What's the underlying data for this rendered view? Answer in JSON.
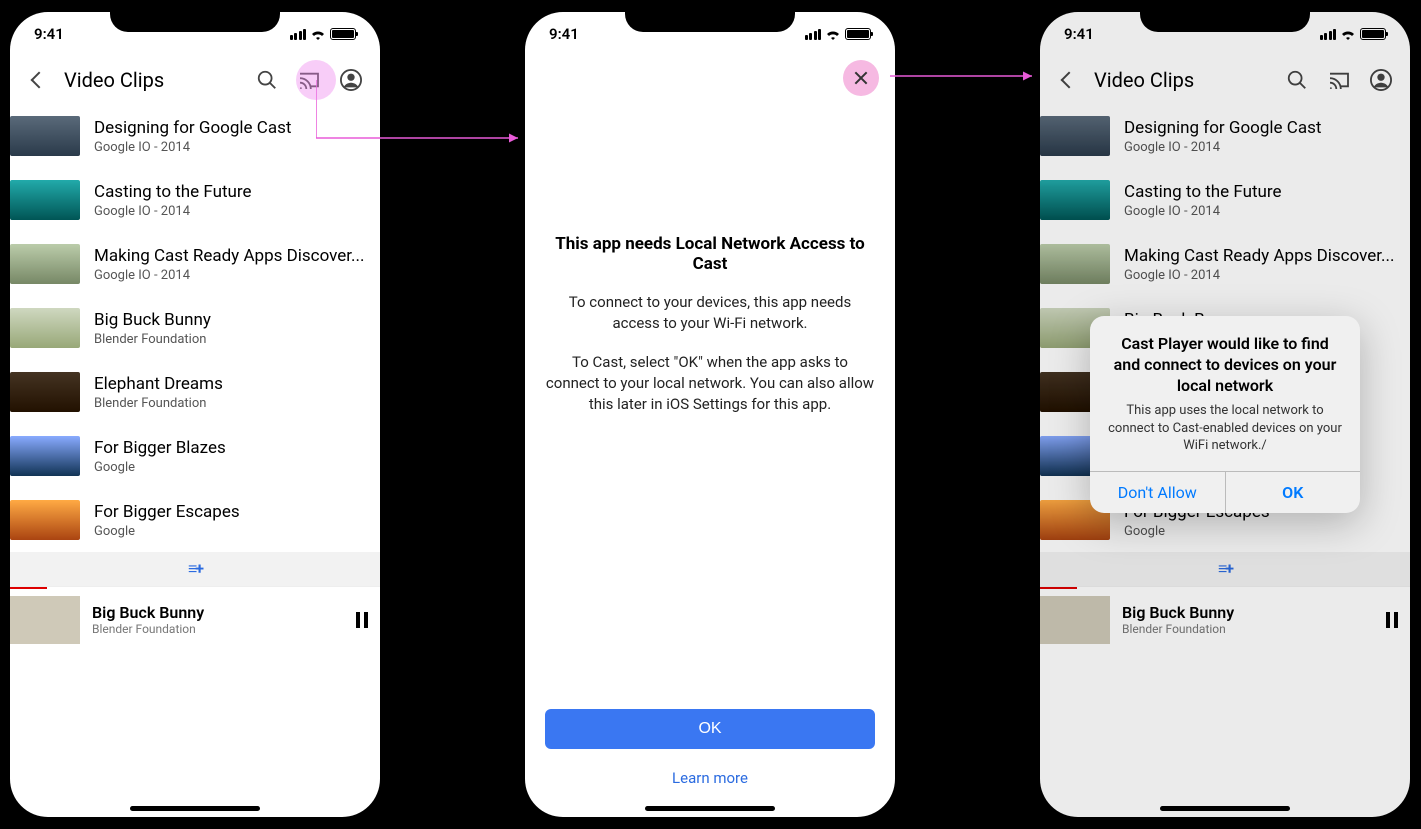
{
  "status": {
    "time": "9:41"
  },
  "header": {
    "title": "Video Clips"
  },
  "videos": [
    {
      "title": "Designing for Google Cast",
      "subtitle": "Google IO - 2014"
    },
    {
      "title": "Casting to the Future",
      "subtitle": "Google IO - 2014"
    },
    {
      "title": "Making Cast Ready Apps Discover...",
      "subtitle": "Google IO - 2014"
    },
    {
      "title": "Big Buck Bunny",
      "subtitle": "Blender Foundation"
    },
    {
      "title": "Elephant Dreams",
      "subtitle": "Blender Foundation"
    },
    {
      "title": "For Bigger Blazes",
      "subtitle": "Google"
    },
    {
      "title": "For Bigger Escapes",
      "subtitle": "Google"
    }
  ],
  "now_playing": {
    "title": "Big Buck Bunny",
    "subtitle": "Blender Foundation"
  },
  "interstitial": {
    "title": "This app needs Local Network Access to Cast",
    "body1": "To connect to your devices, this app needs access to your Wi-Fi network.",
    "body2": "To Cast, select \"OK\" when the app asks to connect to your local network. You can also allow this later in iOS Settings for this app.",
    "ok": "OK",
    "learn": "Learn more"
  },
  "alert": {
    "title": "Cast Player would like to find and connect to devices on your local network",
    "message": "This app uses the local network to connect to Cast-enabled devices on your WiFi network./",
    "dont_allow": "Don't Allow",
    "ok": "OK"
  }
}
